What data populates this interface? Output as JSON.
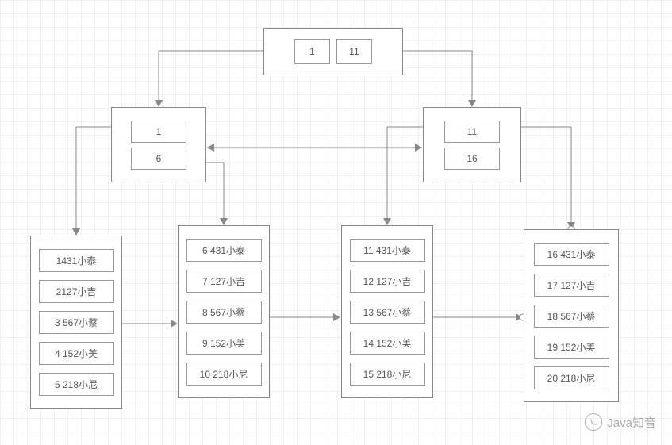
{
  "root": {
    "keys": [
      "1",
      "11"
    ]
  },
  "mid_left": {
    "keys": [
      "1",
      "6"
    ]
  },
  "mid_right": {
    "keys": [
      "11",
      "16"
    ]
  },
  "leaves": [
    {
      "rows": [
        "1431小泰",
        "2127小吉",
        "3 567小蔡",
        "4 152小美",
        "5 218小尼"
      ]
    },
    {
      "rows": [
        "6 431小泰",
        "7 127小吉",
        "8 567小蔡",
        "9 152小美",
        "10 218小尼"
      ]
    },
    {
      "rows": [
        "11 431小泰",
        "12 127小吉",
        "13 567小蔡",
        "14 152小美",
        "15 218小尼"
      ]
    },
    {
      "rows": [
        "16 431小泰",
        "17 127小吉",
        "18 567小蔡",
        "19 152小美",
        "20 218小尼"
      ]
    }
  ],
  "watermark": "Java知音"
}
